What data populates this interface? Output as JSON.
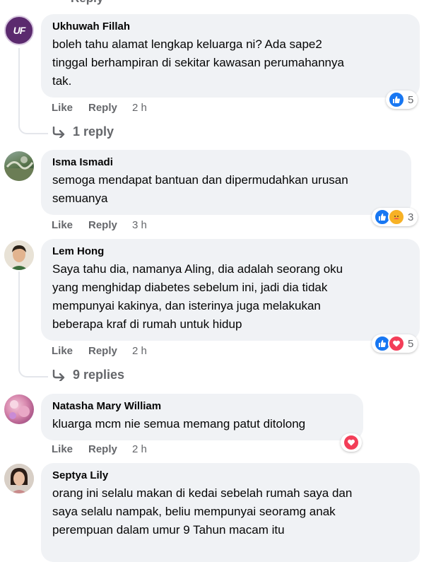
{
  "partial_reply_label": "Reply",
  "comments": [
    {
      "author": "Ukhuwah Fillah",
      "avatar_initials": "UF",
      "lines": [
        "boleh tahu alamat lengkap keluarga ni? Ada sape2",
        "tinggal berhampiran di sekitar kawasan perumahannya",
        "tak."
      ],
      "like": "Like",
      "reply": "Reply",
      "time": "2 h",
      "reaction_count": "5",
      "reaction_types": [
        "like"
      ],
      "replies_label": "1 reply"
    },
    {
      "author": "Isma Ismadi",
      "lines": [
        "semoga mendapat bantuan dan dipermudahkan urusan",
        "semuanya"
      ],
      "like": "Like",
      "reply": "Reply",
      "time": "3 h",
      "reaction_count": "3",
      "reaction_types": [
        "like",
        "care"
      ]
    },
    {
      "author": "Lem Hong",
      "lines": [
        "Saya tahu dia, namanya Aling, dia adalah seorang oku",
        "yang menghidap diabetes sebelum ini, jadi dia tidak",
        "mempunyai kakinya, dan isterinya juga melakukan",
        "beberapa kraf di rumah untuk hidup"
      ],
      "like": "Like",
      "reply": "Reply",
      "time": "2 h",
      "reaction_count": "5",
      "reaction_types": [
        "like",
        "love"
      ],
      "replies_label": "9 replies"
    },
    {
      "author": "Natasha Mary William",
      "lines": [
        "kluarga mcm nie semua memang patut ditolong"
      ],
      "like": "Like",
      "reply": "Reply",
      "time": "2 h",
      "reaction_types": [
        "love"
      ]
    },
    {
      "author": "Septya Lily",
      "lines": [
        "orang ini selalu makan di kedai sebelah rumah saya dan",
        "saya selalu nampak, beliu mempunyai seoramg anak",
        "perempuan dalam umur 9 Tahun macam itu"
      ]
    }
  ],
  "colors": {
    "bubble": "#f0f2f5",
    "like_blue": "#1877f2",
    "love_red": "#f33e58",
    "muted": "#65676b"
  }
}
